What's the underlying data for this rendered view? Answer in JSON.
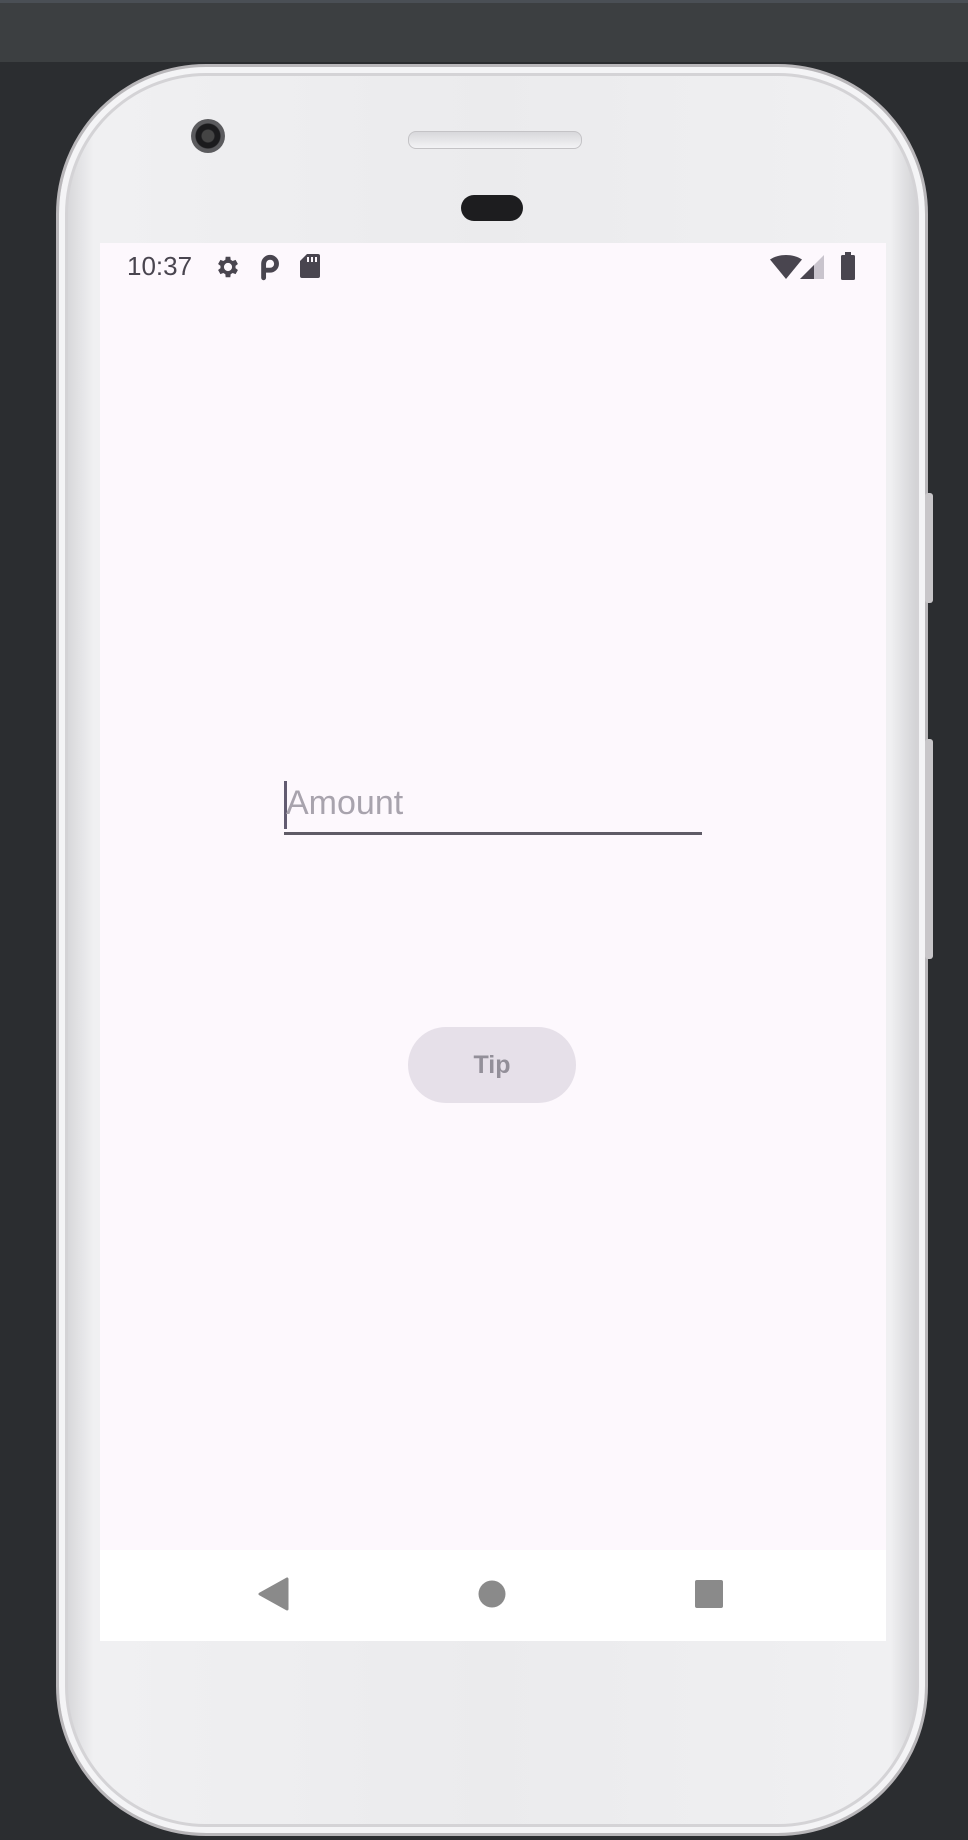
{
  "status_bar": {
    "time": "10:37",
    "left_icons": [
      "gear-icon",
      "parking-icon",
      "sd-card-icon"
    ],
    "right_icons": [
      "wifi-icon",
      "signal-icon",
      "battery-icon"
    ]
  },
  "amount_input": {
    "placeholder": "Amount",
    "value": ""
  },
  "tip_button": {
    "label": "Tip"
  },
  "nav_bar": {
    "buttons": [
      "back-icon",
      "home-icon",
      "recents-icon"
    ]
  },
  "colors": {
    "screen_background": "#fdf8fd",
    "button_background": "#e6e0e9",
    "button_text": "#938f99",
    "field_underline": "#5f5b66",
    "status_icons": "#49454f"
  }
}
